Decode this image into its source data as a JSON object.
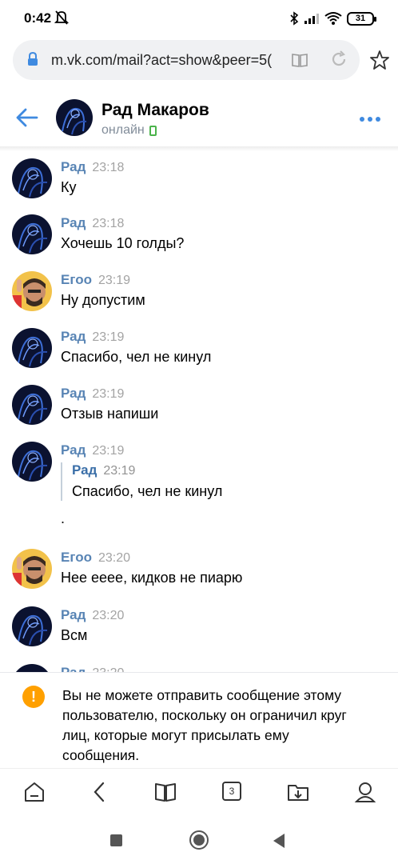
{
  "status_bar": {
    "time": "0:42",
    "battery": "31"
  },
  "browser": {
    "url": "m.vk.com/mail?act=show&peer=5(",
    "tabs_count": "3"
  },
  "chat_header": {
    "name": "Рад Макаров",
    "status": "онлайн"
  },
  "messages": [
    {
      "author": "Рад",
      "time": "23:18",
      "text": "Ку",
      "avatar": "rad"
    },
    {
      "author": "Рад",
      "time": "23:18",
      "text": "Хочешь 10 голды?",
      "avatar": "rad"
    },
    {
      "author": "Егоо",
      "time": "23:19",
      "text": "Ну допустим",
      "avatar": "egoo"
    },
    {
      "author": "Рад",
      "time": "23:19",
      "text": "Спасибо, чел не кинул",
      "avatar": "rad"
    },
    {
      "author": "Рад",
      "time": "23:19",
      "text": "Отзыв напиши",
      "avatar": "rad"
    },
    {
      "author": "Рад",
      "time": "23:19",
      "text": ".",
      "avatar": "rad",
      "forwarded": {
        "author": "Рад",
        "time": "23:19",
        "text": "Спасибо, чел не кинул"
      }
    },
    {
      "author": "Егоо",
      "time": "23:20",
      "text": "Нее ееее, кидков не пиарю",
      "avatar": "egoo"
    },
    {
      "author": "Рад",
      "time": "23:20",
      "text": "Всм",
      "avatar": "rad"
    },
    {
      "author": "Рад",
      "time": "23:20",
      "text": "",
      "avatar": "rad"
    }
  ],
  "warning": {
    "text": "Вы не можете отправить сообщение этому пользователю, поскольку он ограничил круг лиц, которые могут присылать ему сообщения."
  },
  "colors": {
    "link_blue": "#3f8ae0",
    "online_green": "#4bb34b",
    "warning_orange": "#ffa000"
  }
}
